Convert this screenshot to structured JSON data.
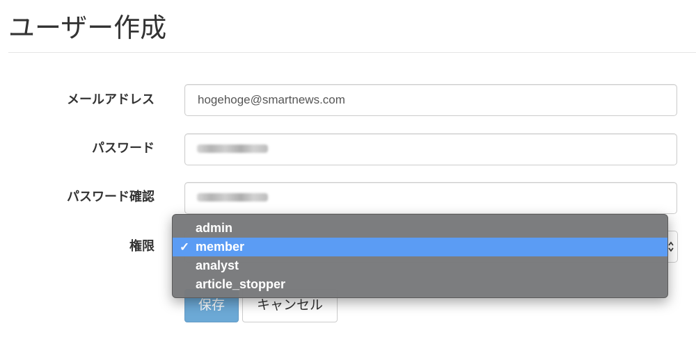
{
  "page": {
    "title": "ユーザー作成"
  },
  "form": {
    "email": {
      "label": "メールアドレス",
      "value": "hogehoge@smartnews.com"
    },
    "password": {
      "label": "パスワード"
    },
    "password_confirm": {
      "label": "パスワード確認"
    },
    "role": {
      "label": "権限",
      "selected": "member",
      "options": [
        "admin",
        "member",
        "analyst",
        "article_stopper"
      ]
    }
  },
  "buttons": {
    "save_label": "保存",
    "cancel_label": "キャンセル"
  },
  "icons": {
    "check": "checkmark-icon",
    "select_arrow": "chevron-up-down-icon"
  },
  "colors": {
    "highlight": "#5b9cf4",
    "dropdown_bg": "#78797b",
    "primary_button": "#3c8dc9"
  }
}
